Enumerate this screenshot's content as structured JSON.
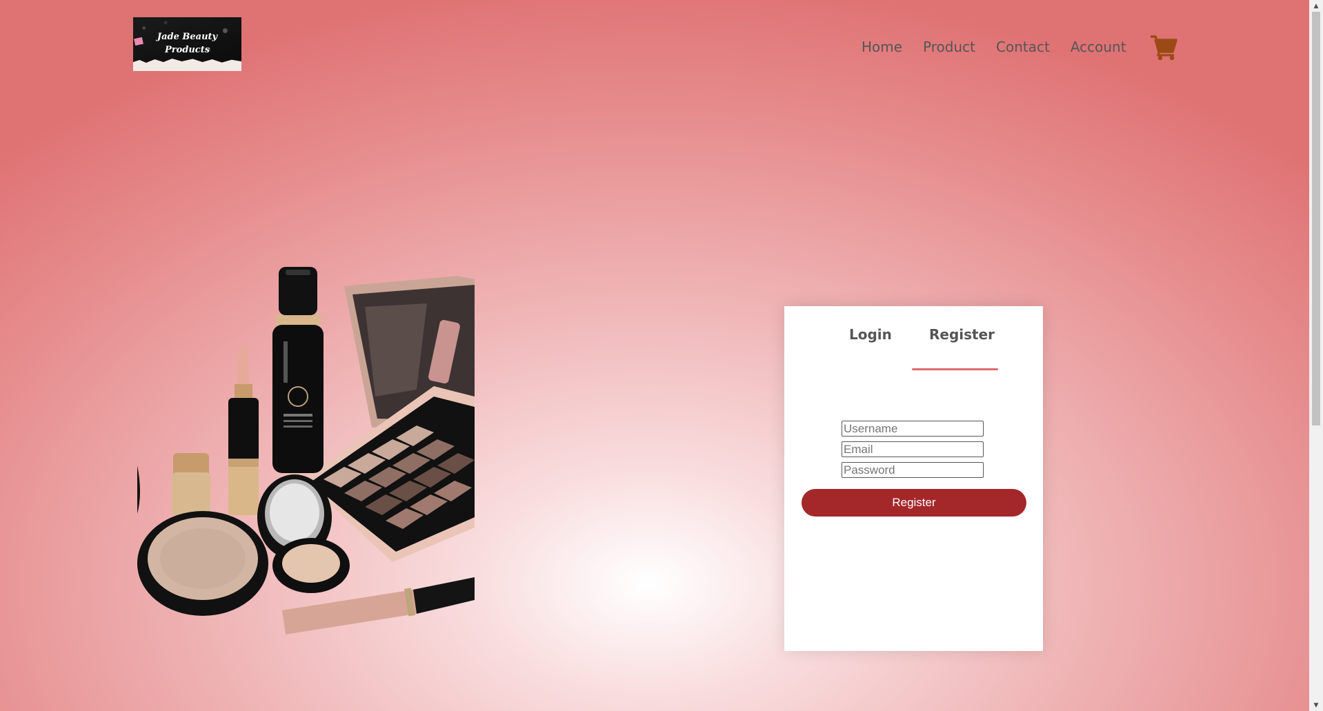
{
  "brand": {
    "logo_text": "Jade Beauty\nProducts"
  },
  "nav": {
    "items": [
      "Home",
      "Product",
      "Contact",
      "Account"
    ],
    "cart_icon": "shopping-cart-icon"
  },
  "auth": {
    "tabs": [
      "Login",
      "Register"
    ],
    "active_tab": "Register",
    "fields": {
      "username_placeholder": "Username",
      "email_placeholder": "Email",
      "password_placeholder": "Password"
    },
    "submit_label": "Register"
  },
  "colors": {
    "accent": "#a4272a",
    "tab_indicator": "#e06b6b",
    "cart": "#9b4a15",
    "text": "#555555"
  }
}
